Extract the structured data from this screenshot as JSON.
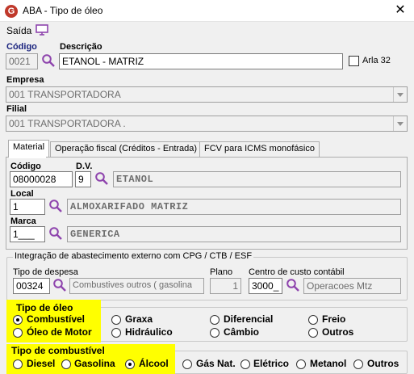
{
  "window": {
    "title": "ABA - Tipo de óleo",
    "app_icon_letter": "G"
  },
  "menu": {
    "saida": "Saída"
  },
  "codigo": {
    "label": "Código",
    "value": "0021"
  },
  "descricao": {
    "label": "Descrição",
    "value": "ETANOL - MATRIZ"
  },
  "arla": {
    "label": "Arla 32",
    "checked": false
  },
  "empresa": {
    "label": "Empresa",
    "value": "001 TRANSPORTADORA"
  },
  "filial": {
    "label": "Filial",
    "value": "001 TRANSPORTADORA ."
  },
  "tabs": [
    {
      "label": "Material",
      "active": true
    },
    {
      "label": "Operação fiscal (Créditos - Entrada)",
      "active": false
    },
    {
      "label": "FCV para ICMS monofásico",
      "active": false
    }
  ],
  "material": {
    "codigo_label": "Código",
    "codigo_value": "08000028",
    "dv_label": "D.V.",
    "dv_value": "9",
    "desc_value": "ETANOL",
    "local_label": "Local",
    "local_code": "1",
    "local_value": "ALMOXARIFADO MATRIZ",
    "marca_label": "Marca",
    "marca_code": "1___",
    "marca_value": "GENERICA"
  },
  "integracao": {
    "title": "Integração de abastecimento externo com CPG / CTB / ESF",
    "tipo_label": "Tipo de despesa",
    "tipo_code": "00324",
    "tipo_value": "Combustives outros ( gasolina",
    "plano_label": "Plano",
    "plano_value": "1",
    "centro_label": "Centro de custo contábil",
    "centro_code": "3000_",
    "centro_value": "Operacoes Mtz"
  },
  "tipo_oleo": {
    "title": "Tipo de óleo",
    "options": [
      "Combustível",
      "Graxa",
      "Diferencial",
      "Freio",
      "Óleo de Motor",
      "Hidráulico",
      "Câmbio",
      "Outros"
    ],
    "selected": "Combustível"
  },
  "tipo_combustivel": {
    "title": "Tipo de combustível",
    "options": [
      "Diesel",
      "Gasolina",
      "Álcool",
      "Gás Nat.",
      "Elétrico",
      "Metanol",
      "Outros"
    ],
    "selected": "Álcool"
  },
  "colors": {
    "highlight": "#ffff00",
    "label_blue": "#1a237e",
    "icon_purple": "#8e44ad"
  }
}
